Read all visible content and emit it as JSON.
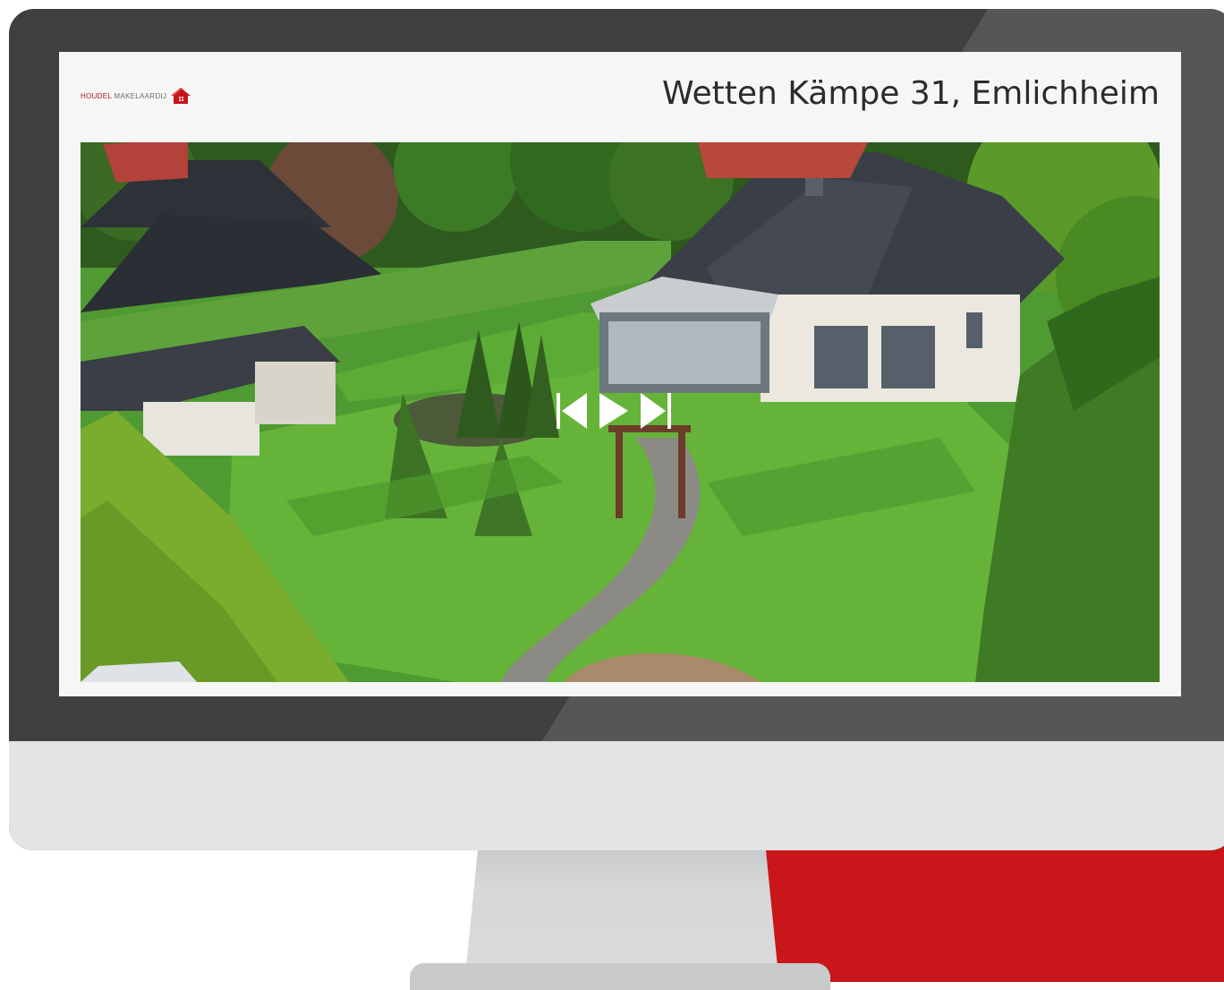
{
  "brand": {
    "name": "HOUDEL",
    "suffix": "MAKELAARDIJ",
    "color": "#c8161b"
  },
  "listing": {
    "address": "Wetten Kämpe 31, Emlichheim"
  },
  "media": {
    "photo_subject": "aerial-house-garden-photo",
    "controls": {
      "previous": "skip-previous-icon",
      "play": "play-icon",
      "next": "skip-next-icon"
    }
  },
  "colors": {
    "monitor_frame": "#3f3f3f",
    "monitor_chin": "#e3e4e6",
    "accent_red": "#c8161b",
    "screen_bg": "#f6f6f6"
  }
}
